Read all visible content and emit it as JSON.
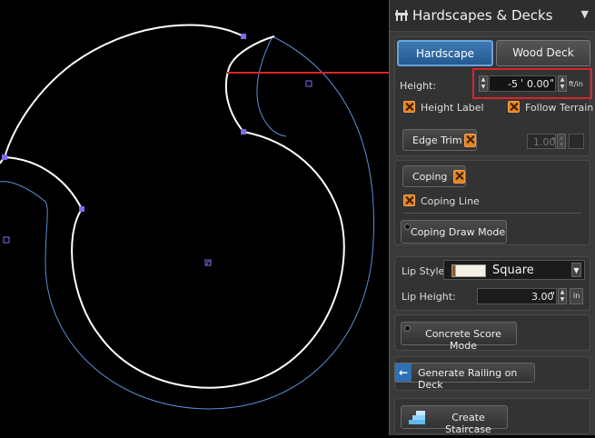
{
  "panel": {
    "title": "Hardscapes & Decks",
    "tabs": [
      {
        "label": "Hardscape",
        "active": true
      },
      {
        "label": "Wood Deck",
        "active": false
      }
    ],
    "height": {
      "label": "Height:",
      "feet": "-5",
      "feet_mark": "'",
      "inches": "0.00",
      "inch_mark": "\"",
      "unit": "ft/in"
    },
    "height_label": {
      "label": "Height Label",
      "checked": true
    },
    "follow_terrain": {
      "label": "Follow Terrain",
      "checked": true
    },
    "edge_trim": {
      "label": "Edge Trim",
      "checked": true,
      "value": "1.00",
      "unit": "\""
    },
    "coping": {
      "label": "Coping",
      "checked": true
    },
    "coping_line": {
      "label": "Coping Line",
      "checked": true
    },
    "coping_draw_mode": "Coping Draw Mode",
    "lip_style": {
      "label": "Lip Style",
      "value": "Square"
    },
    "lip_height": {
      "label": "Lip Height:",
      "value": "3.00",
      "inch_mark": "\"",
      "unit": "in"
    },
    "concrete_score_mode": "Concrete Score Mode",
    "generate_railing": "Generate Railing on Deck",
    "create_staircase": "Create Staircase"
  },
  "colors": {
    "accent_blue": "#3f79b4",
    "checkbox_orange": "#e58322",
    "highlight_red": "#d8262b",
    "handle_purple": "#7b6cf0",
    "outline_blue": "#5b8fd6"
  }
}
